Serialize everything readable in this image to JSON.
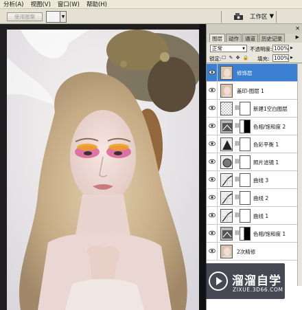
{
  "menu": {
    "items": [
      "分析(A)",
      "视图(V)",
      "窗口(W)",
      "帮助(H)"
    ]
  },
  "options_bar": {
    "use_pattern_label": "使用图案",
    "workspace_label": "工作区",
    "bridge_icon": "bridge-icon"
  },
  "panel": {
    "tabs": [
      "图层",
      "动作",
      "通道",
      "历史记录"
    ],
    "blend_mode": "正常",
    "opacity_label": "不透明度:",
    "opacity_value": "100%",
    "lock_label": "锁定:",
    "fill_label": "填充:",
    "fill_value": "100%",
    "layers": [
      {
        "name": "修饰层",
        "kind": "photo",
        "selected": true
      },
      {
        "name": "盖印-图层 1",
        "kind": "photo",
        "selected": false
      },
      {
        "name": "新建1空白图层",
        "kind": "empty-mask",
        "selected": false
      },
      {
        "name": "色相/饱和度 2",
        "kind": "hue-sat",
        "selected": false
      },
      {
        "name": "色彩平衡 1",
        "kind": "color-balance",
        "selected": false
      },
      {
        "name": "照片滤镜 1",
        "kind": "photo-filter",
        "selected": false
      },
      {
        "name": "曲线 3",
        "kind": "curves",
        "selected": false
      },
      {
        "name": "曲线 2",
        "kind": "curves",
        "selected": false
      },
      {
        "name": "曲线 1",
        "kind": "curves",
        "selected": false
      },
      {
        "name": "色相/饱和度 1",
        "kind": "hue-sat",
        "selected": false
      },
      {
        "name": "2次精修",
        "kind": "photo",
        "selected": false
      }
    ]
  },
  "watermark": {
    "brand": "溜溜自学",
    "domain": "ZIXUE.3D66.COM"
  },
  "colors": {
    "selected_row": "#3a7fd1",
    "panel_bg": "#d6d3c7",
    "menu_bg": "#ece9d8"
  }
}
